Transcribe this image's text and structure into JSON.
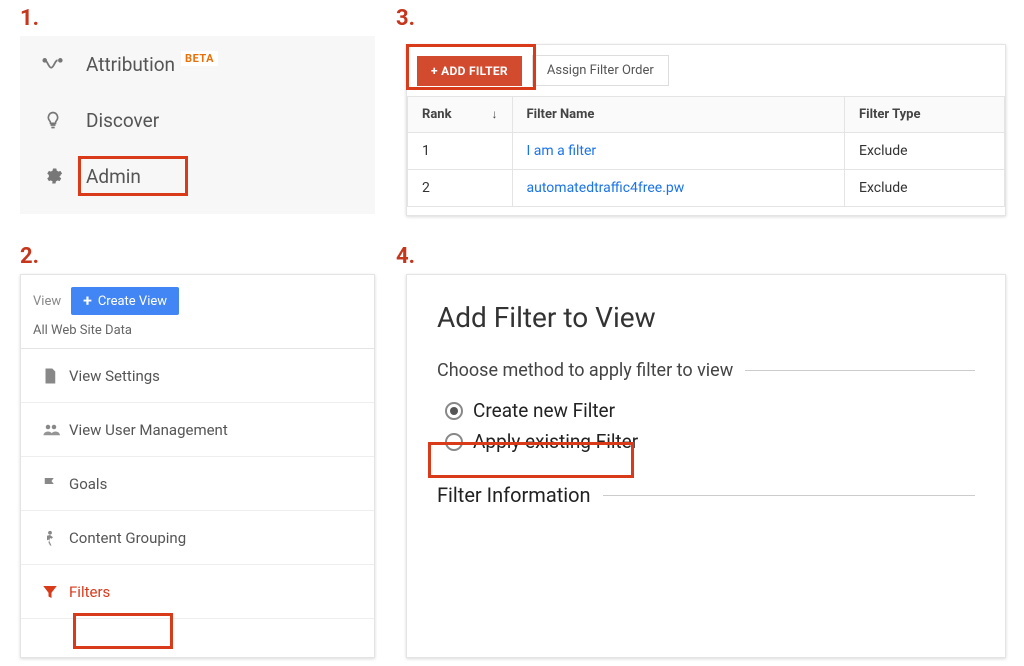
{
  "steps": {
    "one": "1.",
    "two": "2.",
    "three": "3.",
    "four": "4."
  },
  "panel1": {
    "items": [
      {
        "label": "Attribution",
        "badge": "BETA"
      },
      {
        "label": "Discover"
      },
      {
        "label": "Admin"
      }
    ]
  },
  "panel2": {
    "view_label": "View",
    "create_view": "Create View",
    "subtitle": "All Web Site Data",
    "menu": [
      {
        "label": "View Settings"
      },
      {
        "label": "View User Management"
      },
      {
        "label": "Goals"
      },
      {
        "label": "Content Grouping"
      },
      {
        "label": "Filters"
      }
    ]
  },
  "panel3": {
    "add_filter": "+ ADD FILTER",
    "assign_order": "Assign Filter Order",
    "columns": {
      "rank": "Rank",
      "name": "Filter Name",
      "type": "Filter Type"
    },
    "rows": [
      {
        "rank": "1",
        "name": "I am a filter",
        "type": "Exclude"
      },
      {
        "rank": "2",
        "name": "automatedtraffic4free.pw",
        "type": "Exclude"
      }
    ]
  },
  "panel4": {
    "title": "Add Filter to View",
    "choose_method": "Choose method to apply filter to view",
    "option_create": "Create new Filter",
    "option_existing": "Apply existing Filter",
    "filter_info": "Filter Information"
  }
}
